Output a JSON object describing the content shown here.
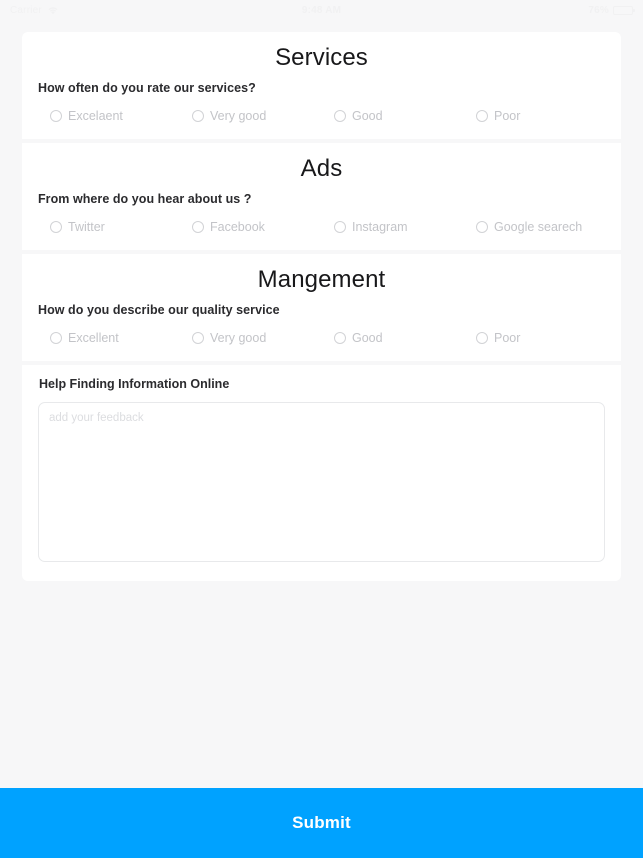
{
  "status_bar": {
    "carrier": "Carrier",
    "wifi_icon": "wifi-icon",
    "time": "9:48 AM",
    "battery_percent": "76%",
    "battery_icon": "battery-icon"
  },
  "theme": {
    "page_background": "#f7f7f8",
    "card_background": "#ffffff",
    "accent": "#00a2ff",
    "title_color": "#18181a",
    "question_color": "#2b2b2e",
    "option_color": "#c3c4c8",
    "radio_border": "#d2d3d6"
  },
  "cards": [
    {
      "title": "Services",
      "question": "How often do you rate our services?",
      "options": [
        "Excelaent",
        "Very good",
        "Good",
        "Poor"
      ]
    },
    {
      "title": "Ads",
      "question": "From where do you hear about us ?",
      "options": [
        "Twitter",
        "Facebook",
        "Instagram",
        "Google searech"
      ]
    },
    {
      "title": "Mangement",
      "question": "How do you describe our quality service",
      "options": [
        "Excellent",
        "Very good",
        "Good",
        "Poor"
      ]
    }
  ],
  "feedback": {
    "title": "Help Finding Information Online",
    "placeholder": "add your feedback",
    "value": ""
  },
  "submit": {
    "label": "Submit"
  }
}
